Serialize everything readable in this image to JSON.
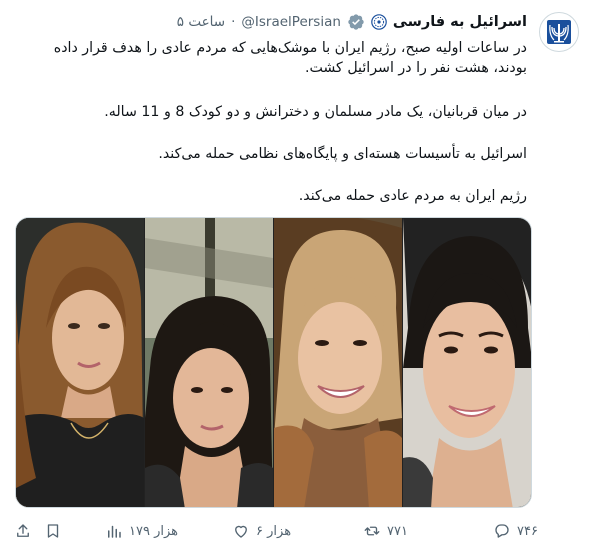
{
  "header": {
    "display_name": "اسرائیل به فارسی",
    "handle": "@IsraelPersian",
    "separator": "·",
    "time": "ساعت ۵"
  },
  "tweet": {
    "paragraphs": [
      "در ساعات اولیه صبح، رژیم ایران با موشک‌هایی که مردم عادی را هدف قرار داده بودند، هشت نفر را در اسرائیل کشت.",
      "در میان قربانیان، یک مادر مسلمان و دخترانش و دو کودک 8 و 11 ساله.",
      "اسرائیل به تأسیسات هسته‌ای و پایگاه‌های نظامی حمله می‌کند.",
      "رژیم ایران به مردم عادی حمله می‌کند."
    ]
  },
  "actions": {
    "replies": "۷۴۶",
    "reposts": "۷۷۱",
    "likes": "۶ هزار",
    "views": "۱۷۹ هزار"
  },
  "colors": {
    "muted": "#536471",
    "verified": "#1d9bf0",
    "text": "#0f1419",
    "emblem_blue": "#1a4f9c"
  },
  "icons": [
    "israel-emblem-icon",
    "verified-badge-icon",
    "reply-icon",
    "repost-icon",
    "like-icon",
    "views-icon",
    "bookmark-icon",
    "share-icon"
  ]
}
